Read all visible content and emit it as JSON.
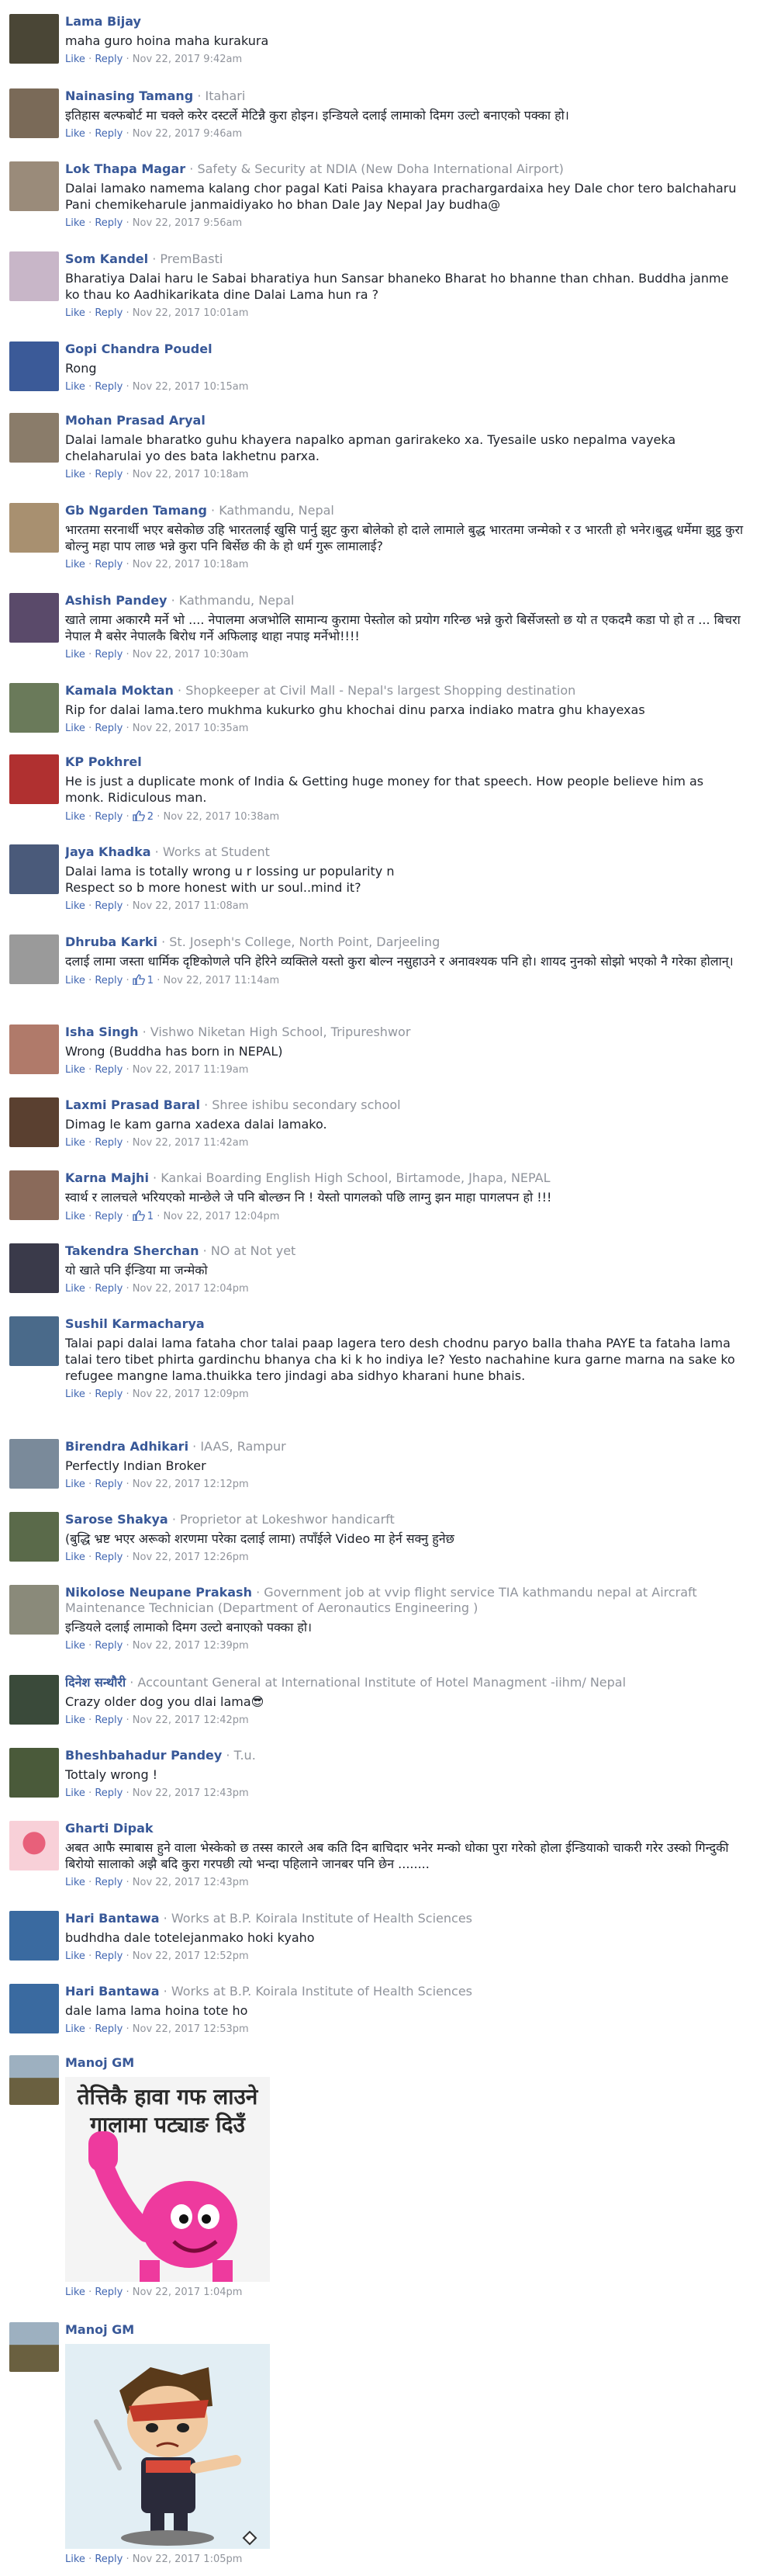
{
  "actions": {
    "like": "Like",
    "reply": "Reply",
    "dot": "·"
  },
  "colors": {
    "name": "#385898",
    "meta": "#90949c",
    "link": "#4267b2"
  },
  "comments": [
    {
      "name": "Lama Bijay",
      "meta": "",
      "text": "maha guro hoina maha kurakura",
      "likes": "",
      "time": "Nov 22, 2017 9:42am",
      "avatar": "#4a4636"
    },
    {
      "name": "Nainasing Tamang",
      "meta": "Itahari",
      "text": "इतिहास बल्फबोर्ट मा चक्ले करेर दस्टर्ले मेटिन्नै कुरा होइन। इन्डियले दलाई लामाको दिमग उल्टो बनाएको पक्का हो।",
      "likes": "",
      "time": "Nov 22, 2017 9:46am",
      "avatar": "#7a6a58"
    },
    {
      "name": "Lok Thapa Magar",
      "meta": "Safety & Security at NDIA (New Doha International Airport)",
      "text": "Dalai lamako namema kalang chor pagal Kati Paisa khayara prachargardaixa hey Dale chor tero balchaharu Pani chemikeharule janmaidiyako ho bhan Dale Jay Nepal Jay budha@",
      "likes": "",
      "time": "Nov 22, 2017 9:56am",
      "avatar": "#9a8b7a"
    },
    {
      "name": "Som Kandel",
      "meta": "PremBasti",
      "text": "Bharatiya Dalai haru le Sabai bharatiya hun Sansar bhaneko Bharat ho bhanne than chhan. Buddha janme ko thau ko Aadhikarikata dine Dalai Lama hun ra ?",
      "likes": "",
      "time": "Nov 22, 2017 10:01am",
      "avatar": "#c8b6c8"
    },
    {
      "name": "Gopi Chandra Poudel",
      "meta": "",
      "text": "Rong",
      "likes": "",
      "time": "Nov 22, 2017 10:15am",
      "avatar": "#3b5a98"
    },
    {
      "name": "Mohan Prasad Aryal",
      "meta": "",
      "text": "Dalai lamale bharatko guhu khayera napalko apman garirakeko xa. Tyesaile usko nepalma vayeka chelaharulai yo des bata lakhetnu parxa.",
      "likes": "",
      "time": "Nov 22, 2017 10:18am",
      "avatar": "#8a7c6a"
    },
    {
      "name": "Gb Ngarden Tamang",
      "meta": "Kathmandu, Nepal",
      "text": "भारतमा सरनार्थी भएर बसेकोछ उहि भारतलाई खुसि पार्नु झुट कुरा बोलेको हो दाले लामाले बुद्ध भारतमा जन्मेको र उ भारती हो भनेर।बुद्ध धर्मेमा झुट्ठ कुरा बोल्नु महा पाप लाछ भन्ने कुरा पनि बिर्सेछ की के हो धर्म गुरू लामालाई?",
      "likes": "",
      "time": "Nov 22, 2017 10:18am",
      "avatar": "#a89070"
    },
    {
      "name": "Ashish Pandey",
      "meta": "Kathmandu, Nepal",
      "text": "खाते लामा अकारमै मर्ने भो .... नेपालमा अजभोलि सामान्य कुरामा पेस्तोल को प्रयोग गरिन्छ भन्ने कुरो बिर्सेजस्तो छ यो त एकदमै कडा पो हो त ... बिचरा नेपाल मै बसेर नेपालकै बिरोध गर्ने अफिलाइ थाहा नपाइ मर्नेभो!!!!",
      "likes": "",
      "time": "Nov 22, 2017 10:30am",
      "avatar": "#5a4a6a"
    },
    {
      "name": "Kamala Moktan",
      "meta": "Shopkeeper at Civil Mall - Nepal's largest Shopping destination",
      "text": "Rip for dalai lama.tero mukhma kukurko ghu khochai dinu parxa indiako matra ghu khayexas",
      "likes": "",
      "time": "Nov 22, 2017 10:35am",
      "avatar": "#6a7a5a"
    },
    {
      "name": "KP Pokhrel",
      "meta": "",
      "text": "He is just a duplicate monk of India & Getting huge money for that speech. How people believe him as monk. Ridiculous man.",
      "likes": "2",
      "time": "Nov 22, 2017 10:38am",
      "avatar": "#b03030"
    },
    {
      "name": "Jaya Khadka",
      "meta": "Works at Student",
      "text": "Dalai lama is totally wrong u r lossing ur popularity n\nRespect so b more honest with ur soul..mind it?",
      "likes": "",
      "time": "Nov 22, 2017 11:08am",
      "avatar": "#4a5a7a"
    },
    {
      "name": "Dhruba Karki",
      "meta": "St. Joseph's College, North Point, Darjeeling",
      "text": "दलाई लामा जस्ता धार्मिक दृष्टिकोणले पनि हेरिने व्यक्तिले यस्तो कुरा बोल्न नसुहाउने र अनावश्यक पनि हो। शायद नुनको सोझो भएको नै गरेका होलान्।",
      "likes": "1",
      "time": "Nov 22, 2017 11:14am",
      "avatar": "#9a9a9a"
    },
    {
      "name": "Isha Singh",
      "meta": "Vishwo Niketan High School, Tripureshwor",
      "text": "Wrong (Buddha has born in NEPAL)",
      "likes": "",
      "time": "Nov 22, 2017 11:19am",
      "avatar": "#b07a6a"
    },
    {
      "name": "Laxmi Prasad Baral",
      "meta": "Shree ishibu secondary school",
      "text": "Dimag le kam garna xadexa dalai lamako.",
      "likes": "",
      "time": "Nov 22, 2017 11:42am",
      "avatar": "#5a4030"
    },
    {
      "name": "Karna Majhi",
      "meta": "Kankai Boarding English High School, Birtamode, Jhapa, NEPAL",
      "text": "स्वार्थ र लालचले भरियएको मान्छेले जे पनि बोल्छन नि ! येस्तो पागलको पछि लाग्नु झन माहा पागलपन हो !!!",
      "likes": "1",
      "time": "Nov 22, 2017 12:04pm",
      "avatar": "#8a6a5a"
    },
    {
      "name": "Takendra Sherchan",
      "meta": "NO at Not yet",
      "text": "यो खाते पनि ईन्डिया मा जन्मेको",
      "likes": "",
      "time": "Nov 22, 2017 12:04pm",
      "avatar": "#3a3a4a"
    },
    {
      "name": "Sushil Karmacharya",
      "meta": "",
      "text": "Talai papi dalai lama fataha chor talai paap lagera tero desh chodnu paryo balla thaha PAYE ta fataha lama talai tero tibet phirta gardinchu bhanya cha ki k ho indiya le? Yesto nachahine kura garne marna na sake ko refugee mangne lama.thuikka tero jindagi aba sidhyo kharani hune bhais.",
      "likes": "",
      "time": "Nov 22, 2017 12:09pm",
      "avatar": "#4a6a8a"
    },
    {
      "name": "Birendra Adhikari",
      "meta": "IAAS, Rampur",
      "text": "Perfectly Indian Broker",
      "likes": "",
      "time": "Nov 22, 2017 12:12pm",
      "avatar": "#7a8a9a"
    },
    {
      "name": "Sarose Shakya",
      "meta": "Proprietor at Lokeshwor handicarft",
      "text": "(बुद्धि भ्रष्ट भएर अरूको शरणमा परेका दलाई लामा) तपाँईले Video मा हेर्न सक्नु हुनेछ",
      "likes": "",
      "time": "Nov 22, 2017 12:26pm",
      "avatar": "#5a6a4a"
    },
    {
      "name": "Nikolose Neupane Prakash",
      "meta": "Government job at vvip flight service TIA kathmandu nepal at Aircraft Maintenance Technician (Department of Aeronautics Engineering )",
      "text": "इन्डियले दलाई लामाको दिमग उल्टो बनाएको पक्का हो।",
      "likes": "",
      "time": "Nov 22, 2017 12:39pm",
      "avatar": "#8a8a7a"
    },
    {
      "name": "दिनेश सन्थौरी",
      "meta": "Accountant General at International Institute of Hotel Managment -iihm/ Nepal",
      "text": "Crazy older dog you dlai lama😎",
      "likes": "",
      "time": "Nov 22, 2017 12:42pm",
      "avatar": "#3a4a3a"
    },
    {
      "name": "Bheshbahadur Pandey",
      "meta": "T.u.",
      "text": "Tottaly wrong !",
      "likes": "",
      "time": "Nov 22, 2017 12:43pm",
      "avatar": "#4a5a3a"
    },
    {
      "name": "Gharti Dipak",
      "meta": "",
      "text": "अबत आफै स्माबास हुने वाला भेस्केको छ तस्स कारले अब कति दिन बाचिदार भनेर मन्को धोका पुरा गरेको होला ईन्डियाको चाकरी गरेर उस्को गिन्दुकी बिरोयो सालाको अझै बदि कुरा गरपछी त्यो भन्दा पहिलाने जानबर पनि छेन ........",
      "likes": "",
      "time": "Nov 22, 2017 12:43pm",
      "avatar": "#e07080"
    },
    {
      "name": "Hari Bantawa",
      "meta": "Works at B.P. Koirala Institute of Health Sciences",
      "text": "budhdha dale totelejanmako hoki kyaho",
      "likes": "",
      "time": "Nov 22, 2017 12:52pm",
      "avatar": "#3a6aa0"
    },
    {
      "name": "Hari Bantawa",
      "meta": "Works at B.P. Koirala Institute of Health Sciences",
      "text": "dale lama lama hoina tote ho",
      "likes": "",
      "time": "Nov 22, 2017 12:53pm",
      "avatar": "#3a6aa0"
    },
    {
      "name": "Manoj GM",
      "meta": "",
      "text": "",
      "sticker": "pink",
      "sticker_text": "तेत्तिकै हावा गफ लाउने\nगालामा पट्याङ दिउँ",
      "likes": "",
      "time": "Nov 22, 2017 1:04pm",
      "avatar": "#8a9aaa"
    },
    {
      "name": "Manoj GM",
      "meta": "",
      "text": "",
      "sticker": "cartoon",
      "sticker_text": "",
      "likes": "",
      "time": "Nov 22, 2017 1:05pm",
      "avatar": "#8a9aaa"
    }
  ]
}
